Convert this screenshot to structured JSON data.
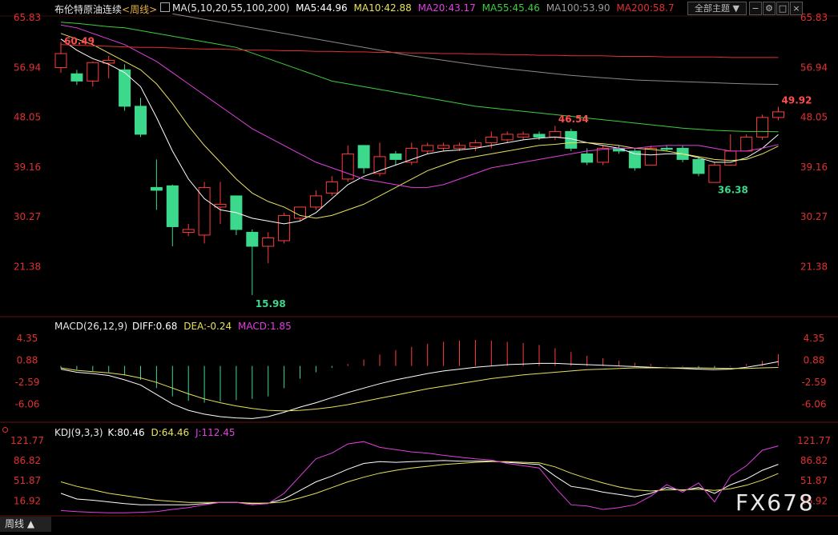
{
  "header": {
    "title": "布伦特原油连续",
    "period": "<周线>",
    "ma_label": "MA(5,10,20,55,100,200)",
    "ma5": "MA5:44.96",
    "ma10": "MA10:42.88",
    "ma20": "MA20:43.17",
    "ma55": "MA55:45.46",
    "ma100": "MA100:53.90",
    "ma200": "MA200:58.7",
    "theme_button": "全部主题",
    "colors": {
      "ma5": "#ffffff",
      "ma10": "#e8e25a",
      "ma20": "#e040e0",
      "ma55": "#3ccf3c",
      "ma100": "#8a8a8a",
      "ma200": "#e03030"
    }
  },
  "macd_header": {
    "label": "MACD(26,12,9)",
    "diff": "DIFF:0.68",
    "dea": "DEA:-0.24",
    "macd": "MACD:1.85"
  },
  "kdj_header": {
    "label": "KDJ(9,3,3)",
    "k": "K:80.46",
    "d": "D:64.46",
    "j": "J:112.45"
  },
  "footer": {
    "tab": "周线 ▲",
    "watermark": "FX678"
  },
  "chart_data": [
    {
      "type": "candlestick",
      "panel": "price",
      "ylim": [
        15.0,
        65.83
      ],
      "yticks": [
        "65.83",
        "56.94",
        "48.05",
        "39.16",
        "30.27",
        "21.38"
      ],
      "candles": [
        {
          "o": 56.9,
          "h": 61.5,
          "l": 56.0,
          "c": 59.4
        },
        {
          "o": 55.8,
          "h": 56.5,
          "l": 53.8,
          "c": 54.5
        },
        {
          "o": 54.5,
          "h": 58.0,
          "l": 53.5,
          "c": 57.8
        },
        {
          "o": 57.7,
          "h": 59.0,
          "l": 55.0,
          "c": 58.2
        },
        {
          "o": 56.5,
          "h": 57.5,
          "l": 49.2,
          "c": 50.0
        },
        {
          "o": 50.0,
          "h": 51.5,
          "l": 44.5,
          "c": 45.0
        },
        {
          "o": 35.5,
          "h": 40.5,
          "l": 31.5,
          "c": 35.0
        },
        {
          "o": 35.8,
          "h": 36.0,
          "l": 25.0,
          "c": 28.5
        },
        {
          "o": 27.5,
          "h": 29.0,
          "l": 26.8,
          "c": 28.0
        },
        {
          "o": 27.0,
          "h": 36.5,
          "l": 25.5,
          "c": 35.5
        },
        {
          "o": 32.0,
          "h": 36.5,
          "l": 29.0,
          "c": 32.5
        },
        {
          "o": 34.0,
          "h": 34.0,
          "l": 27.0,
          "c": 28.0
        },
        {
          "o": 27.5,
          "h": 28.0,
          "l": 16.3,
          "c": 25.0
        },
        {
          "o": 25.0,
          "h": 27.5,
          "l": 22.0,
          "c": 26.5
        },
        {
          "o": 26.0,
          "h": 31.0,
          "l": 25.5,
          "c": 30.5
        },
        {
          "o": 30.0,
          "h": 32.0,
          "l": 29.5,
          "c": 32.0
        },
        {
          "o": 32.0,
          "h": 35.0,
          "l": 31.5,
          "c": 34.0
        },
        {
          "o": 34.5,
          "h": 37.5,
          "l": 34.0,
          "c": 36.5
        },
        {
          "o": 37.0,
          "h": 43.0,
          "l": 36.5,
          "c": 41.5
        },
        {
          "o": 43.0,
          "h": 43.0,
          "l": 38.0,
          "c": 39.0
        },
        {
          "o": 38.0,
          "h": 43.5,
          "l": 37.5,
          "c": 41.0
        },
        {
          "o": 41.5,
          "h": 42.0,
          "l": 39.5,
          "c": 40.5
        },
        {
          "o": 40.0,
          "h": 43.5,
          "l": 39.5,
          "c": 42.5
        },
        {
          "o": 42.0,
          "h": 43.5,
          "l": 41.5,
          "c": 43.0
        },
        {
          "o": 42.5,
          "h": 43.5,
          "l": 42.0,
          "c": 43.0
        },
        {
          "o": 42.5,
          "h": 43.5,
          "l": 42.0,
          "c": 43.0
        },
        {
          "o": 42.8,
          "h": 44.0,
          "l": 42.0,
          "c": 43.5
        },
        {
          "o": 43.5,
          "h": 45.5,
          "l": 42.5,
          "c": 44.5
        },
        {
          "o": 44.0,
          "h": 45.5,
          "l": 43.5,
          "c": 45.0
        },
        {
          "o": 44.5,
          "h": 45.5,
          "l": 44.0,
          "c": 45.0
        },
        {
          "o": 45.0,
          "h": 45.5,
          "l": 44.0,
          "c": 44.5
        },
        {
          "o": 44.5,
          "h": 46.5,
          "l": 44.0,
          "c": 45.5
        },
        {
          "o": 45.5,
          "h": 46.0,
          "l": 42.0,
          "c": 42.5
        },
        {
          "o": 41.5,
          "h": 42.5,
          "l": 39.5,
          "c": 40.0
        },
        {
          "o": 40.0,
          "h": 43.0,
          "l": 39.5,
          "c": 42.5
        },
        {
          "o": 42.5,
          "h": 43.0,
          "l": 41.5,
          "c": 42.0
        },
        {
          "o": 42.0,
          "h": 42.5,
          "l": 38.5,
          "c": 39.0
        },
        {
          "o": 39.5,
          "h": 43.0,
          "l": 39.5,
          "c": 42.5
        },
        {
          "o": 42.5,
          "h": 43.0,
          "l": 42.0,
          "c": 42.3
        },
        {
          "o": 42.5,
          "h": 43.0,
          "l": 40.0,
          "c": 40.5
        },
        {
          "o": 40.5,
          "h": 41.0,
          "l": 37.5,
          "c": 38.0
        },
        {
          "o": 36.4,
          "h": 40.0,
          "l": 36.4,
          "c": 39.5
        },
        {
          "o": 39.5,
          "h": 45.0,
          "l": 39.5,
          "c": 42.0
        },
        {
          "o": 42.0,
          "h": 45.0,
          "l": 42.0,
          "c": 44.5
        },
        {
          "o": 44.5,
          "h": 48.5,
          "l": 44.0,
          "c": 48.0
        },
        {
          "o": 48.0,
          "h": 49.9,
          "l": 47.5,
          "c": 49.0
        }
      ],
      "annotations": [
        {
          "text": "60.49",
          "index": 0,
          "value": 60.49
        },
        {
          "text": "15.98",
          "index": 12,
          "value": 15.98
        },
        {
          "text": "46.54",
          "index": 31,
          "value": 46.54
        },
        {
          "text": "36.38",
          "index": 41,
          "value": 36.38
        },
        {
          "text": "49.92",
          "index": 45,
          "value": 49.92
        }
      ],
      "series": [
        {
          "name": "MA5",
          "color": "#ffffff",
          "values": [
            62.0,
            60.0,
            58.5,
            57.5,
            56.0,
            53.5,
            48.0,
            42.0,
            37.0,
            33.5,
            31.5,
            31.0,
            30.0,
            29.5,
            29.0,
            29.5,
            31.0,
            33.5,
            36.0,
            37.5,
            38.5,
            39.5,
            40.5,
            41.5,
            42.0,
            42.2,
            42.5,
            43.0,
            43.5,
            44.0,
            44.3,
            44.5,
            44.2,
            43.5,
            43.0,
            42.5,
            41.5,
            41.3,
            41.5,
            41.5,
            40.8,
            40.0,
            40.0,
            40.8,
            42.5,
            44.96
          ]
        },
        {
          "name": "MA10",
          "color": "#e8e25a",
          "values": [
            63.0,
            62.0,
            61.0,
            59.5,
            58.0,
            56.5,
            54.0,
            50.5,
            46.5,
            43.0,
            40.0,
            37.0,
            34.5,
            33.0,
            32.0,
            30.5,
            30.0,
            30.5,
            31.5,
            32.5,
            34.0,
            35.5,
            37.0,
            38.5,
            39.5,
            40.5,
            41.0,
            41.5,
            42.0,
            42.5,
            43.0,
            43.2,
            43.5,
            43.5,
            43.3,
            43.0,
            42.5,
            42.3,
            42.0,
            41.5,
            41.0,
            40.5,
            40.3,
            40.5,
            41.5,
            42.88
          ]
        },
        {
          "name": "MA20",
          "color": "#e040e0",
          "values": [
            64.5,
            64.0,
            63.0,
            62.0,
            61.0,
            59.5,
            58.0,
            56.0,
            54.0,
            52.0,
            50.0,
            48.0,
            46.0,
            44.5,
            43.0,
            41.5,
            40.0,
            39.0,
            38.0,
            37.0,
            36.5,
            36.0,
            35.5,
            35.5,
            36.0,
            37.0,
            38.0,
            39.0,
            39.5,
            40.0,
            40.5,
            41.0,
            41.5,
            42.0,
            42.3,
            42.5,
            42.5,
            42.8,
            43.0,
            43.0,
            43.0,
            42.5,
            42.0,
            42.0,
            42.5,
            43.17
          ]
        },
        {
          "name": "MA55",
          "color": "#3ccf3c",
          "values": [
            65.0,
            64.8,
            64.5,
            64.2,
            64.0,
            63.5,
            63.0,
            62.5,
            62.0,
            61.5,
            61.0,
            60.5,
            59.5,
            58.5,
            57.5,
            56.5,
            55.5,
            54.5,
            54.0,
            53.5,
            53.0,
            52.5,
            52.0,
            51.5,
            51.0,
            50.5,
            50.0,
            49.7,
            49.4,
            49.1,
            48.8,
            48.5,
            48.2,
            47.9,
            47.6,
            47.3,
            47.0,
            46.7,
            46.4,
            46.1,
            45.9,
            45.7,
            45.6,
            45.5,
            45.5,
            45.46
          ]
        },
        {
          "name": "MA100",
          "color": "#8a8a8a",
          "values": [
            null,
            null,
            null,
            null,
            null,
            null,
            null,
            66.5,
            66.0,
            65.5,
            65.0,
            64.5,
            64.0,
            63.5,
            63.0,
            62.5,
            62.0,
            61.5,
            61.0,
            60.5,
            60.0,
            59.5,
            59.0,
            58.6,
            58.2,
            57.8,
            57.4,
            57.0,
            56.7,
            56.4,
            56.1,
            55.8,
            55.5,
            55.3,
            55.1,
            54.9,
            54.7,
            54.6,
            54.5,
            54.4,
            54.3,
            54.2,
            54.1,
            54.0,
            53.95,
            53.9
          ]
        },
        {
          "name": "MA200",
          "color": "#e03030",
          "values": [
            61.0,
            60.9,
            60.8,
            60.7,
            60.6,
            60.5,
            60.5,
            60.4,
            60.3,
            60.2,
            60.2,
            60.1,
            60.0,
            60.0,
            59.9,
            59.9,
            59.8,
            59.8,
            59.7,
            59.7,
            59.6,
            59.6,
            59.5,
            59.5,
            59.4,
            59.4,
            59.3,
            59.3,
            59.2,
            59.2,
            59.1,
            59.1,
            59.0,
            59.0,
            59.0,
            58.9,
            58.9,
            58.9,
            58.8,
            58.8,
            58.8,
            58.8,
            58.7,
            58.7,
            58.7,
            58.7
          ]
        }
      ]
    },
    {
      "type": "bar",
      "panel": "macd",
      "ylim": [
        -8.5,
        6.0
      ],
      "yticks": [
        "4.35",
        "0.88",
        "-2.59",
        "-6.06"
      ],
      "histogram": [
        -0.4,
        -0.6,
        -0.8,
        -1.0,
        -1.5,
        -2.2,
        -3.5,
        -4.8,
        -5.5,
        -5.8,
        -5.6,
        -5.4,
        -5.2,
        -4.8,
        -3.5,
        -2.0,
        -1.0,
        -0.3,
        0.3,
        1.0,
        1.8,
        2.5,
        3.0,
        3.5,
        3.8,
        4.0,
        4.1,
        4.0,
        3.8,
        3.6,
        3.3,
        2.8,
        2.2,
        1.6,
        1.2,
        0.8,
        0.5,
        0.3,
        0.1,
        -0.1,
        -0.3,
        -0.4,
        -0.1,
        0.3,
        0.8,
        1.85
      ],
      "series": [
        {
          "name": "DIFF",
          "color": "#ffffff",
          "values": [
            -0.5,
            -1.0,
            -1.2,
            -1.5,
            -2.2,
            -3.0,
            -4.5,
            -6.0,
            -7.0,
            -7.6,
            -8.0,
            -8.2,
            -8.3,
            -8.0,
            -7.3,
            -6.5,
            -5.8,
            -5.0,
            -4.2,
            -3.5,
            -2.8,
            -2.2,
            -1.7,
            -1.2,
            -0.8,
            -0.5,
            -0.2,
            0.0,
            0.2,
            0.3,
            0.4,
            0.4,
            0.3,
            0.2,
            0.1,
            0.0,
            -0.1,
            -0.2,
            -0.3,
            -0.4,
            -0.5,
            -0.6,
            -0.5,
            -0.2,
            0.2,
            0.68
          ]
        },
        {
          "name": "DEA",
          "color": "#e8e25a",
          "values": [
            -0.3,
            -0.7,
            -0.9,
            -1.1,
            -1.4,
            -1.9,
            -2.6,
            -3.5,
            -4.4,
            -5.2,
            -5.8,
            -6.3,
            -6.7,
            -7.0,
            -7.1,
            -7.0,
            -6.8,
            -6.5,
            -6.1,
            -5.6,
            -5.1,
            -4.6,
            -4.1,
            -3.6,
            -3.2,
            -2.8,
            -2.4,
            -2.0,
            -1.7,
            -1.4,
            -1.2,
            -1.0,
            -0.8,
            -0.6,
            -0.5,
            -0.4,
            -0.3,
            -0.3,
            -0.3,
            -0.3,
            -0.3,
            -0.35,
            -0.4,
            -0.4,
            -0.3,
            -0.24
          ]
        }
      ]
    },
    {
      "type": "line",
      "panel": "kdj",
      "ylim": [
        -5,
        130
      ],
      "yticks": [
        "121.77",
        "86.82",
        "51.87",
        "16.92"
      ],
      "series": [
        {
          "name": "K",
          "color": "#ffffff",
          "values": [
            30,
            20,
            18,
            15,
            12,
            10,
            10,
            10,
            10,
            12,
            14,
            14,
            12,
            13,
            20,
            35,
            50,
            60,
            72,
            82,
            85,
            84,
            85,
            86,
            87,
            86,
            86,
            86,
            84,
            82,
            80,
            60,
            42,
            38,
            32,
            28,
            24,
            30,
            40,
            35,
            40,
            30,
            45,
            55,
            70,
            80.46
          ]
        },
        {
          "name": "D",
          "color": "#e8e25a",
          "values": [
            50,
            42,
            36,
            30,
            26,
            22,
            18,
            16,
            14,
            14,
            14,
            14,
            13,
            13,
            15,
            22,
            30,
            40,
            50,
            58,
            65,
            70,
            74,
            77,
            80,
            82,
            84,
            85,
            85,
            84,
            83,
            76,
            65,
            56,
            48,
            41,
            36,
            34,
            36,
            36,
            37,
            35,
            38,
            44,
            53,
            64.46
          ]
        },
        {
          "name": "J",
          "color": "#e040e0",
          "values": [
            0,
            -2,
            -3,
            -4,
            -4,
            -3,
            -2,
            2,
            5,
            10,
            14,
            14,
            10,
            12,
            30,
            60,
            90,
            100,
            116,
            120,
            110,
            106,
            102,
            100,
            96,
            93,
            90,
            88,
            82,
            78,
            74,
            40,
            10,
            8,
            2,
            5,
            10,
            25,
            45,
            32,
            48,
            15,
            60,
            78,
            105,
            112.45
          ]
        }
      ]
    }
  ]
}
